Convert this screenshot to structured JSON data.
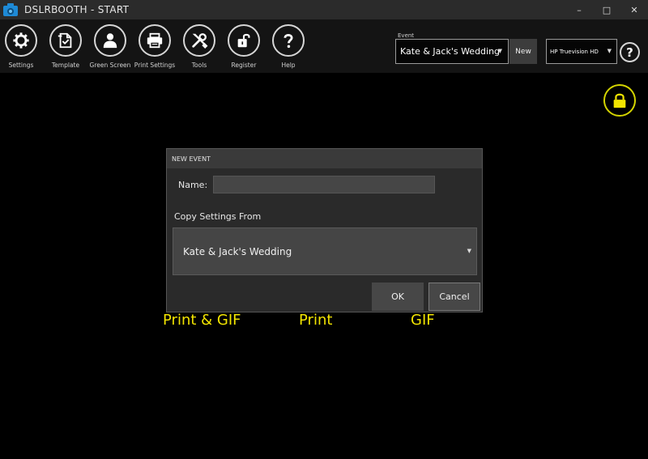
{
  "window": {
    "title": "DSLRBOOTH - START",
    "minimize": "–",
    "maximize": "□",
    "close": "✕"
  },
  "toolbar": {
    "items": [
      {
        "label": "Settings",
        "icon": "gear-icon"
      },
      {
        "label": "Template",
        "icon": "template-icon"
      },
      {
        "label": "Green Screen",
        "icon": "person-icon"
      },
      {
        "label": "Print Settings",
        "icon": "printer-icon"
      },
      {
        "label": "Tools",
        "icon": "tools-icon"
      },
      {
        "label": "Register",
        "icon": "unlock-icon"
      },
      {
        "label": "Help",
        "icon": "question-icon"
      }
    ],
    "event_label": "Event",
    "event_selected": "Kate & Jack's Wedding",
    "new_label": "New",
    "camera_selected": "HP Truevision HD",
    "help_glyph": "?"
  },
  "modes": [
    "Print & GIF",
    "Print",
    "GIF"
  ],
  "dialog": {
    "title": "NEW EVENT",
    "name_label": "Name:",
    "name_value": "",
    "copy_label": "Copy Settings From",
    "copy_selected": "Kate & Jack's Wedding",
    "ok_label": "OK",
    "cancel_label": "Cancel"
  },
  "colors": {
    "accent_yellow": "#f2e400",
    "lock_yellow": "#d4d400"
  }
}
